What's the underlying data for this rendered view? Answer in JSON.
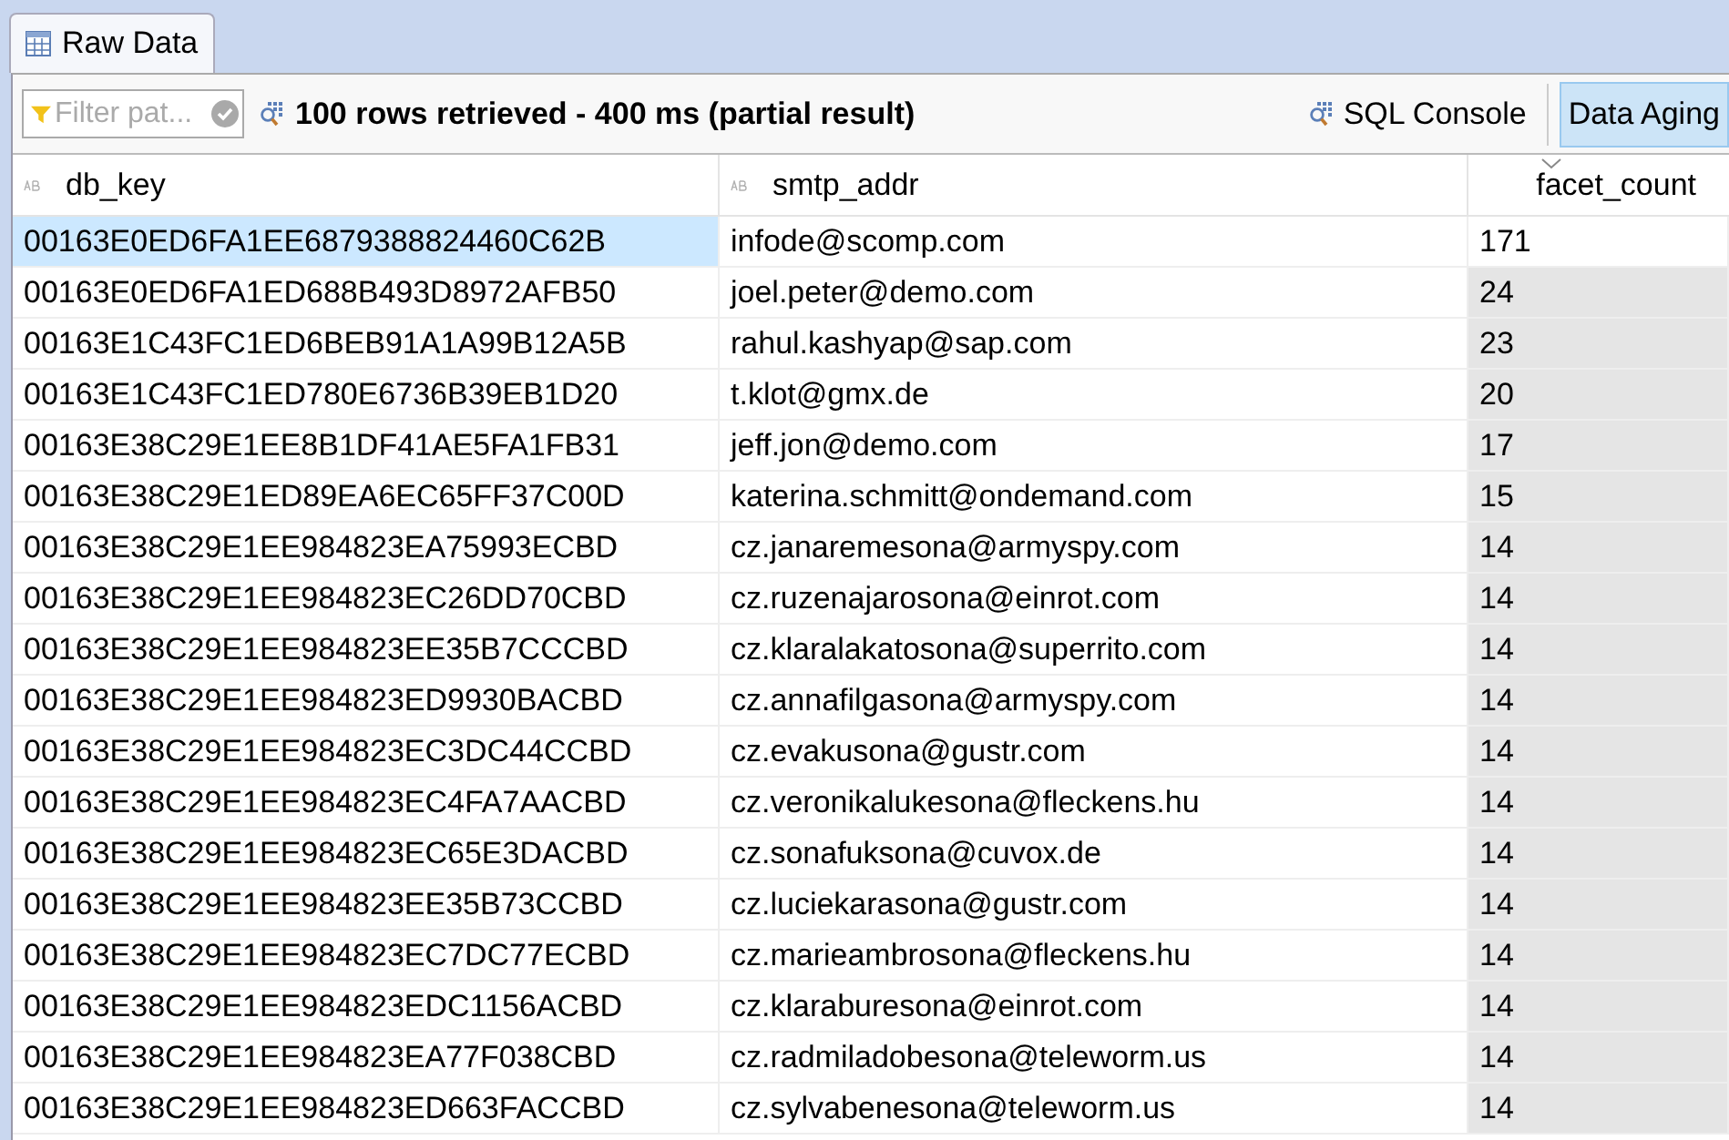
{
  "tabs": [
    {
      "label": "Raw Data",
      "selected": true
    }
  ],
  "toolbar": {
    "filter": {
      "placeholder": "Filter pat..."
    },
    "status": "100 rows retrieved - 400 ms (partial result)",
    "buttons": [
      {
        "label": "SQL Console",
        "kind": "console",
        "selected": false
      },
      {
        "label": "Data Aging",
        "kind": "toggle",
        "selected": true
      }
    ]
  },
  "table": {
    "columns": [
      {
        "label": "db_key",
        "sorted": false
      },
      {
        "label": "smtp_addr",
        "sorted": false
      },
      {
        "label": "facet_count",
        "sorted": true
      }
    ],
    "rows": [
      {
        "cells": [
          "00163E0ED6FA1EE6879388824460C62B",
          "infode@scomp.com",
          "171"
        ],
        "selected": true
      },
      {
        "cells": [
          "00163E0ED6FA1ED688B493D8972AFB50",
          "joel.peter@demo.com",
          "24"
        ],
        "selected": false
      },
      {
        "cells": [
          "00163E1C43FC1ED6BEB91A1A99B12A5B",
          "rahul.kashyap@sap.com",
          "23"
        ],
        "selected": false
      },
      {
        "cells": [
          "00163E1C43FC1ED780E6736B39EB1D20",
          "t.klot@gmx.de",
          "20"
        ],
        "selected": false
      },
      {
        "cells": [
          "00163E38C29E1EE8B1DF41AE5FA1FB31",
          "jeff.jon@demo.com",
          "17"
        ],
        "selected": false
      },
      {
        "cells": [
          "00163E38C29E1ED89EA6EC65FF37C00D",
          "katerina.schmitt@ondemand.com",
          "15"
        ],
        "selected": false
      },
      {
        "cells": [
          "00163E38C29E1EE984823EA75993ECBD",
          "cz.janaremesona@armyspy.com",
          "14"
        ],
        "selected": false
      },
      {
        "cells": [
          "00163E38C29E1EE984823EC26DD70CBD",
          "cz.ruzenajarosona@einrot.com",
          "14"
        ],
        "selected": false
      },
      {
        "cells": [
          "00163E38C29E1EE984823EE35B7CCCBD",
          "cz.klaralakatosona@superrito.com",
          "14"
        ],
        "selected": false
      },
      {
        "cells": [
          "00163E38C29E1EE984823ED9930BACBD",
          "cz.annafilgasona@armyspy.com",
          "14"
        ],
        "selected": false
      },
      {
        "cells": [
          "00163E38C29E1EE984823EC3DC44CCBD",
          "cz.evakusona@gustr.com",
          "14"
        ],
        "selected": false
      },
      {
        "cells": [
          "00163E38C29E1EE984823EC4FA7AACBD",
          "cz.veronikalukesona@fleckens.hu",
          "14"
        ],
        "selected": false
      },
      {
        "cells": [
          "00163E38C29E1EE984823EC65E3DACBD",
          "cz.sonafuksona@cuvox.de",
          "14"
        ],
        "selected": false
      },
      {
        "cells": [
          "00163E38C29E1EE984823EE35B73CCBD",
          "cz.luciekarasona@gustr.com",
          "14"
        ],
        "selected": false
      },
      {
        "cells": [
          "00163E38C29E1EE984823EC7DC77ECBD",
          "cz.marieambrosona@fleckens.hu",
          "14"
        ],
        "selected": false
      },
      {
        "cells": [
          "00163E38C29E1EE984823EDC1156ACBD",
          "cz.klaraburesona@einrot.com",
          "14"
        ],
        "selected": false
      },
      {
        "cells": [
          "00163E38C29E1EE984823EA77F038CBD",
          "cz.radmiladobesona@teleworm.us",
          "14"
        ],
        "selected": false
      },
      {
        "cells": [
          "00163E38C29E1EE984823ED663FACCBD",
          "cz.sylvabenesona@teleworm.us",
          "14"
        ],
        "selected": false
      }
    ]
  }
}
